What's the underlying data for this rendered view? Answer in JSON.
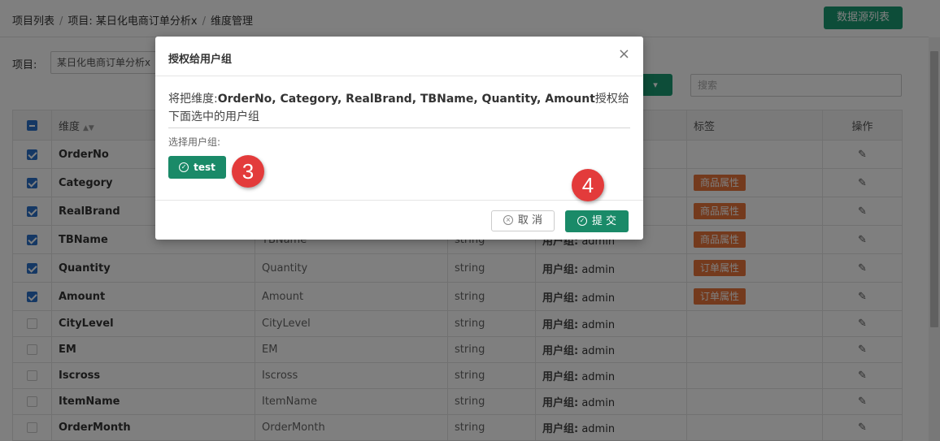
{
  "breadcrumb": [
    "项目列表",
    "项目: 某日化电商订单分析x",
    "维度管理"
  ],
  "header_button": "数据源列表",
  "project": {
    "label": "项目:",
    "value": "某日化电商订单分析x"
  },
  "search": {
    "placeholder": "搜索"
  },
  "table": {
    "headers": [
      "维度",
      "标签",
      "操作"
    ],
    "rows": [
      {
        "checked": true,
        "name": "OrderNo",
        "alias": "",
        "type": "",
        "group_label": "",
        "group_value": "",
        "tag": ""
      },
      {
        "checked": true,
        "name": "Category",
        "alias": "",
        "type": "",
        "group_label": "",
        "group_value": "",
        "tag": "商品属性"
      },
      {
        "checked": true,
        "name": "RealBrand",
        "alias": "",
        "type": "",
        "group_label": "",
        "group_value": "",
        "tag": "商品属性"
      },
      {
        "checked": true,
        "name": "TBName",
        "alias": "TBName",
        "type": "string",
        "group_label": "用户组:",
        "group_value": "admin",
        "tag": "商品属性"
      },
      {
        "checked": true,
        "name": "Quantity",
        "alias": "Quantity",
        "type": "string",
        "group_label": "用户组:",
        "group_value": "admin",
        "tag": "订单属性"
      },
      {
        "checked": true,
        "name": "Amount",
        "alias": "Amount",
        "type": "string",
        "group_label": "用户组:",
        "group_value": "admin",
        "tag": "订单属性"
      },
      {
        "checked": false,
        "name": "CityLevel",
        "alias": "CityLevel",
        "type": "string",
        "group_label": "用户组:",
        "group_value": "admin",
        "tag": ""
      },
      {
        "checked": false,
        "name": "EM",
        "alias": "EM",
        "type": "string",
        "group_label": "用户组:",
        "group_value": "admin",
        "tag": ""
      },
      {
        "checked": false,
        "name": "Iscross",
        "alias": "Iscross",
        "type": "string",
        "group_label": "用户组:",
        "group_value": "admin",
        "tag": ""
      },
      {
        "checked": false,
        "name": "ItemName",
        "alias": "ItemName",
        "type": "string",
        "group_label": "用户组:",
        "group_value": "admin",
        "tag": ""
      },
      {
        "checked": false,
        "name": "OrderMonth",
        "alias": "OrderMonth",
        "type": "string",
        "group_label": "用户组:",
        "group_value": "admin",
        "tag": ""
      }
    ]
  },
  "modal": {
    "title": "授权给用户组",
    "close": "×",
    "message_prefix": "将把维度:",
    "message_dims": "OrderNo, Category, RealBrand, TBName, Quantity, Amount",
    "message_suffix": "授权给下面选中的用户组",
    "select_label": "选择用户组:",
    "group_button": "test",
    "cancel": "取 消",
    "submit": "提 交"
  },
  "steps": [
    "3",
    "4"
  ],
  "colors": {
    "primary": "#1a8a68",
    "tag": "#e8743b",
    "checkbox": "#2b71c9",
    "marker": "#e33b3b"
  }
}
